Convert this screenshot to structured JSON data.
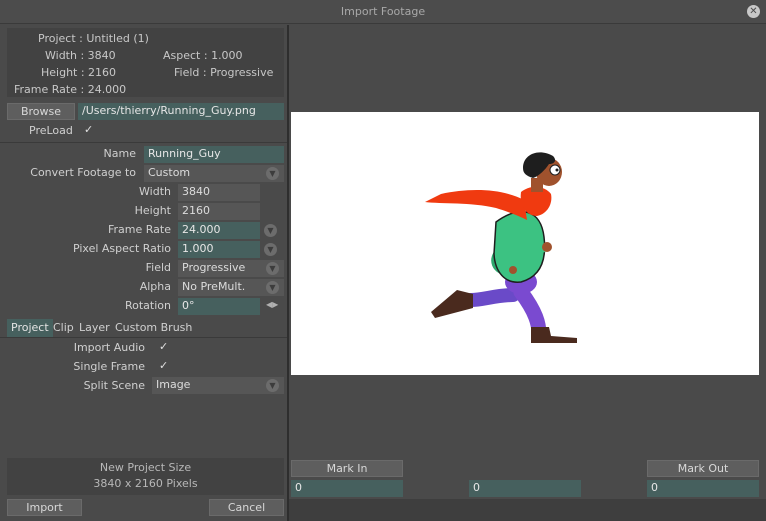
{
  "window": {
    "title": "Import Footage",
    "close": "✕"
  },
  "info": {
    "project": "Project : Untitled (1)",
    "width": "Width : 3840",
    "aspect": "Aspect : 1.000",
    "height": "Height : 2160",
    "field": "Field : Progressive",
    "frame_rate": "Frame Rate : 24.000"
  },
  "browse": {
    "label": "Browse",
    "path": "/Users/thierry/Running_Guy.png"
  },
  "preload": {
    "label": "PreLoad",
    "checked": "✓"
  },
  "form": {
    "name_label": "Name",
    "name_value": "Running_Guy",
    "convert_label": "Convert Footage to",
    "convert_value": "Custom",
    "width_label": "Width",
    "width_value": "3840",
    "height_label": "Height",
    "height_value": "2160",
    "frame_rate_label": "Frame Rate",
    "frame_rate_value": "24.000",
    "par_label": "Pixel Aspect Ratio",
    "par_value": "1.000",
    "field_label": "Field",
    "field_value": "Progressive",
    "alpha_label": "Alpha",
    "alpha_value": "No PreMult.",
    "rotation_label": "Rotation",
    "rotation_value": "0°"
  },
  "tabs": [
    "Project",
    "Clip",
    "Layer",
    "Custom Brush"
  ],
  "project_tab": {
    "import_audio_label": "Import Audio",
    "import_audio_check": "✓",
    "single_frame_label": "Single Frame",
    "single_frame_check": "✓",
    "split_scene_label": "Split Scene",
    "split_scene_value": "Image"
  },
  "new_size": {
    "title": "New Project Size",
    "value": "3840 x 2160 Pixels"
  },
  "actions": {
    "import": "Import",
    "cancel": "Cancel"
  },
  "marks": {
    "mark_in": "Mark In",
    "mark_out": "Mark Out",
    "in_value": "0",
    "mid_value": "0",
    "out_value": "0"
  },
  "colors": {
    "accent_field": "#46605e",
    "scarf": "#f03a10",
    "sweater": "#3cc282",
    "pants": "#7a4ad0"
  }
}
